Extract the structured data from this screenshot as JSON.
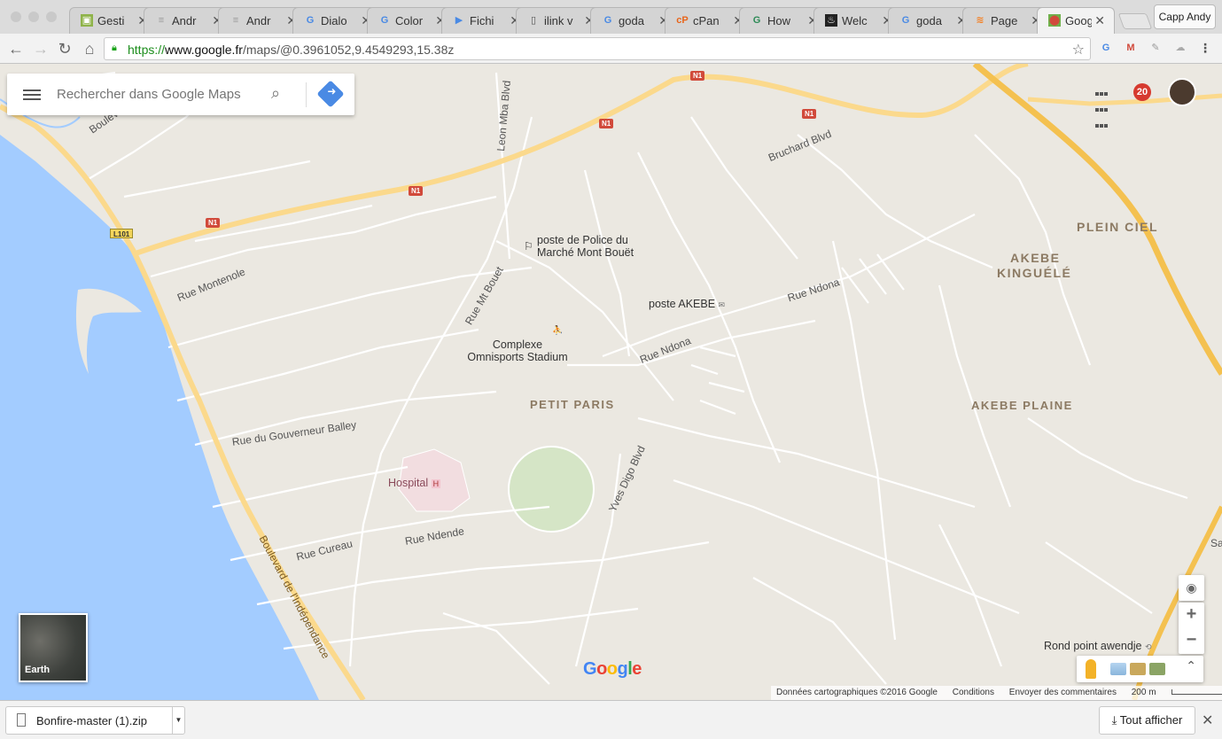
{
  "browser": {
    "tabs": [
      {
        "label": "Gesti",
        "icon": "generic-app-icon"
      },
      {
        "label": "Andr",
        "icon": "android-icon"
      },
      {
        "label": "Andr",
        "icon": "android-icon"
      },
      {
        "label": "Dialo",
        "icon": "google-icon"
      },
      {
        "label": "Color",
        "icon": "google-icon"
      },
      {
        "label": "Fichi",
        "icon": "play-icon"
      },
      {
        "label": "ilink v",
        "icon": "document-icon"
      },
      {
        "label": "goda",
        "icon": "google-icon"
      },
      {
        "label": "cPan",
        "icon": "cpanel-icon"
      },
      {
        "label": "How",
        "icon": "grammarly-icon"
      },
      {
        "label": "Welc",
        "icon": "flame-icon"
      },
      {
        "label": "goda",
        "icon": "google-icon"
      },
      {
        "label": "Page",
        "icon": "stackoverflow-icon"
      },
      {
        "label": "Goog",
        "icon": "maps-icon",
        "active": true
      }
    ],
    "profile_name": "Capp Andy",
    "url": {
      "scheme": "https://",
      "host": "www.google.fr",
      "path": "/maps/@0.3961052,9.4549293,15.38z"
    }
  },
  "maps": {
    "search_placeholder": "Rechercher dans Google Maps",
    "notifications_count": "20",
    "earth_label": "Earth",
    "logo": "Google",
    "footer": {
      "attribution": "Données cartographiques ©2016 Google",
      "terms": "Conditions",
      "feedback": "Envoyer des commentaires",
      "scale": "200 m"
    },
    "streets": {
      "boulevard_triomphal": "Boulevard Triompha",
      "leon_mba": "Leon Mba Blvd",
      "bruchard": "Bruchard Blvd",
      "rue_montenole": "Rue Montenole",
      "rue_mt_bouet": "Rue Mt Bouet",
      "rue_ndona_1": "Rue Ndona",
      "rue_ndona_2": "Rue Ndona",
      "rue_gouverneur": "Rue du Gouverneur Balley",
      "yves_digo": "Yves Digo Blvd",
      "rue_ndende": "Rue Ndende",
      "rue_cureau": "Rue Cureau",
      "bd_independance": "Boulevard de l'Indépendance",
      "sa": "Sa"
    },
    "highways": {
      "n1": "N1",
      "l101": "L101"
    },
    "pois": {
      "police_line1": "poste de Police du",
      "police_line2": "Marché Mont Bouët",
      "poste_akebe": "poste AKEBE",
      "complexe_line1": "Complexe",
      "complexe_line2": "Omnisports Stadium",
      "hospital": "Hospital",
      "rond_point": "Rond point awendje"
    },
    "areas": {
      "petit_paris": "PETIT PARIS",
      "plein_ciel": "PLEIN CIEL",
      "akebe_kinguele_1": "AKEBE",
      "akebe_kinguele_2": "KINGUÉLÉ",
      "akebe_plaine": "AKEBE PLAINE"
    }
  },
  "downloads": {
    "file_name": "Bonfire-master (1).zip",
    "show_all": "Tout afficher"
  },
  "colors": {
    "water": "#a3ccff",
    "land": "#ebe8e1",
    "highway": "#fbd98c",
    "highway_red": "#d14a3b",
    "maps_blue": "#4a8ae4"
  }
}
